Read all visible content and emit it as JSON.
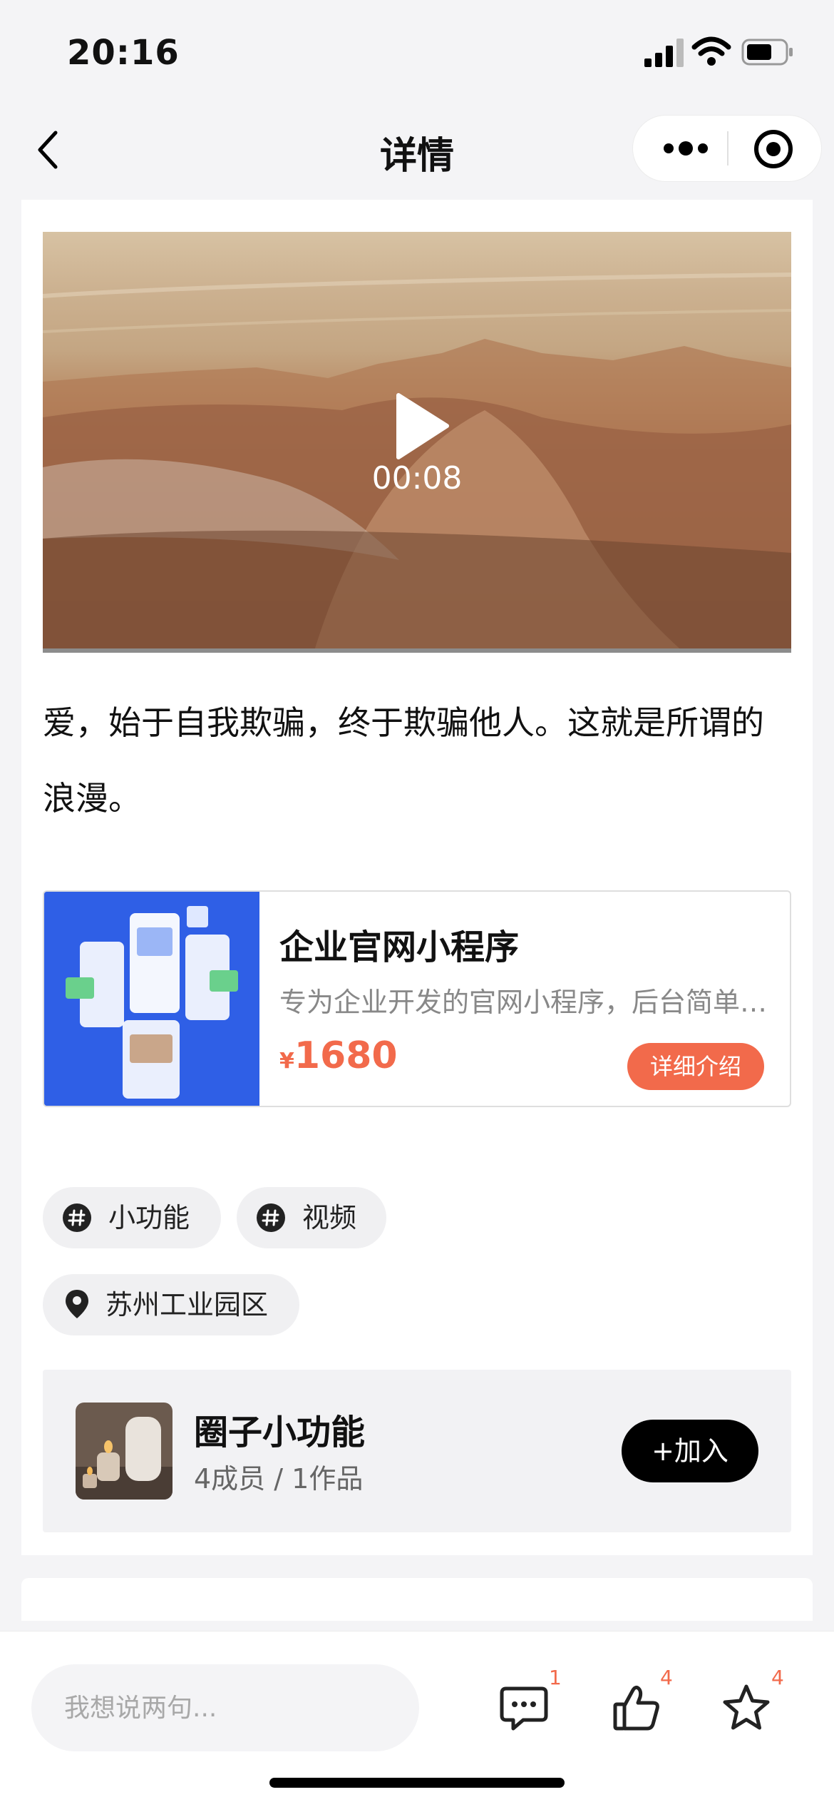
{
  "status_bar": {
    "time": "20:16"
  },
  "nav": {
    "title": "详情"
  },
  "video": {
    "duration": "00:08",
    "progress": 0.0
  },
  "post": {
    "text": "爱，始于自我欺骗，终于欺骗他人。这就是所谓的浪漫。"
  },
  "product": {
    "title": "企业官网小程序",
    "description": "专为企业开发的官网小程序，后台简单…",
    "currency": "¥",
    "price": "1680",
    "detail_label": "详细介绍"
  },
  "tags": [
    {
      "label": "小功能",
      "icon": "hashtag-icon"
    },
    {
      "label": "视频",
      "icon": "hashtag-icon"
    }
  ],
  "location": {
    "label": "苏州工业园区",
    "icon": "location-pin-icon"
  },
  "circle": {
    "name": "圈子小功能",
    "meta": "4成员 / 1作品",
    "join_label": "+加入"
  },
  "bottom_bar": {
    "comment_placeholder": "我想说两句...",
    "comment_count": "1",
    "like_count": "4",
    "favorite_count": "4"
  },
  "colors": {
    "accent": "#f26a4b",
    "background": "#f4f4f6"
  }
}
